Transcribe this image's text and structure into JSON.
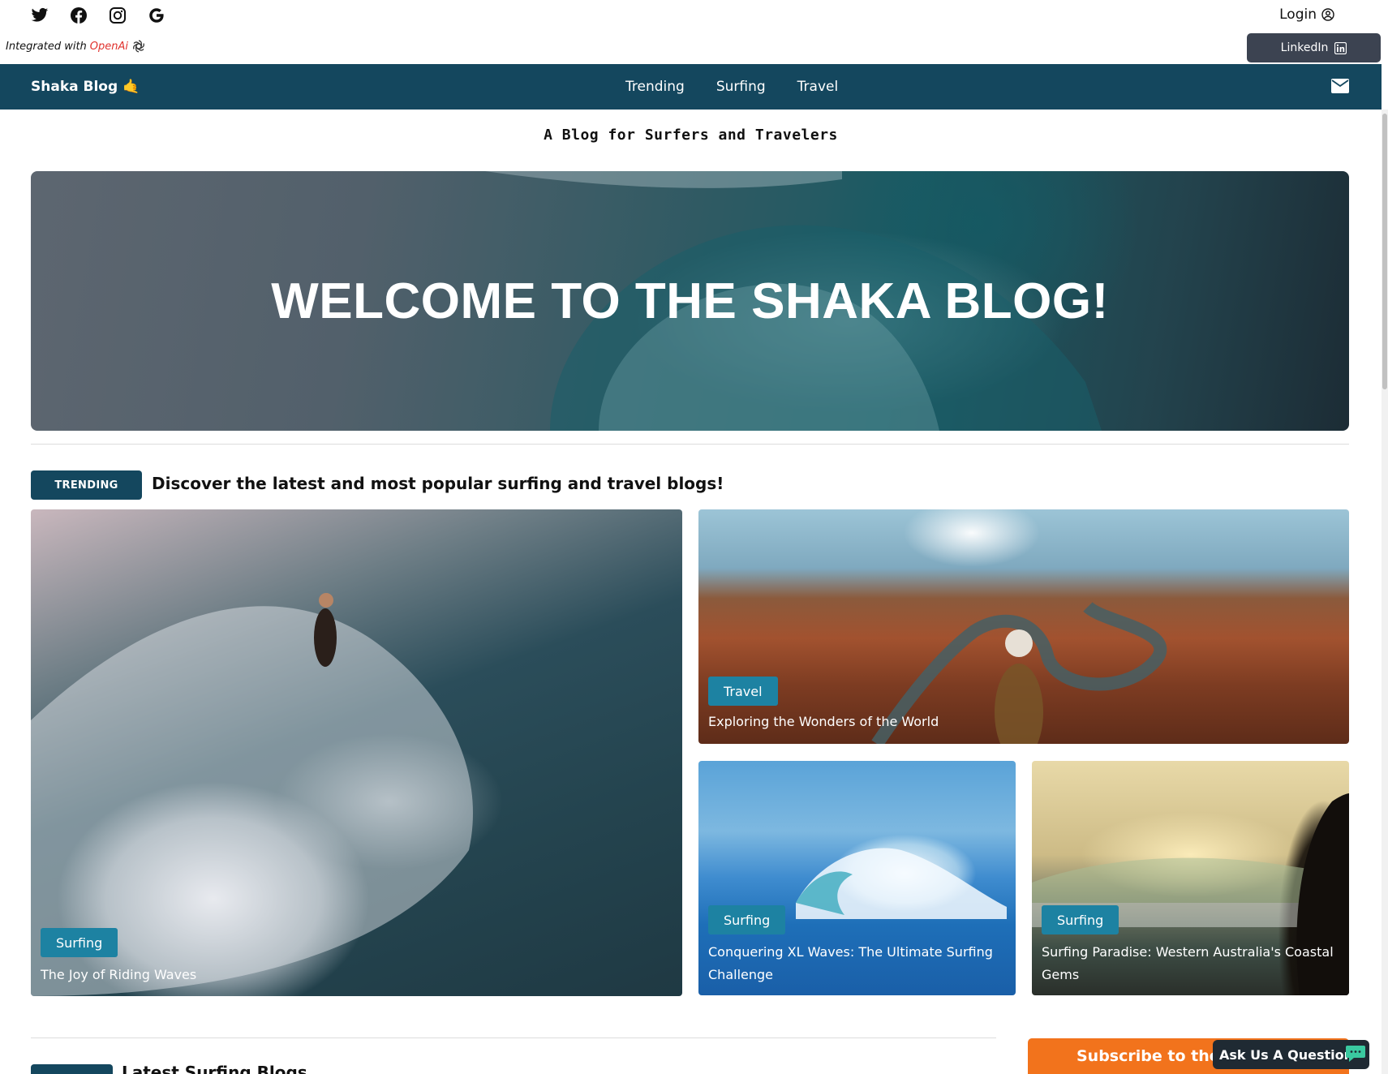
{
  "social": {
    "icons": [
      "twitter-icon",
      "facebook-icon",
      "instagram-icon",
      "google-icon"
    ],
    "login_label": "Login"
  },
  "integrated": {
    "prefix": "Integrated with",
    "brand": "OpenAi"
  },
  "linkedin_label": "LinkedIn",
  "nav": {
    "brand": "Shaka Blog",
    "brand_emoji": "🤙",
    "links": [
      "Trending",
      "Surfing",
      "Travel"
    ]
  },
  "tagline": "A Blog for Surfers and Travelers",
  "hero": {
    "title": "WELCOME TO THE SHAKA BLOG!"
  },
  "trending": {
    "pill": "TRENDING",
    "description": "Discover the latest and most popular surfing and travel blogs!",
    "cards": [
      {
        "category": "Surfing",
        "title": "The Joy of Riding Waves"
      },
      {
        "category": "Travel",
        "title": "Exploring the Wonders of the World"
      },
      {
        "category": "Surfing",
        "title": "Conquering XL Waves: The Ultimate Surfing Challenge"
      },
      {
        "category": "Surfing",
        "title": "Surfing Paradise: Western Australia's Coastal Gems"
      }
    ]
  },
  "latest": {
    "title": "Latest Surfing Blogs"
  },
  "subscribe_label": "Subscribe to the Shaka Blog",
  "ask_label": "Ask Us A Question",
  "colors": {
    "navbar": "#14475e",
    "badge": "#1d82a2",
    "subscribe": "#f2731c",
    "linkedin_button": "#3c4351",
    "openai_text": "#e0322d"
  }
}
